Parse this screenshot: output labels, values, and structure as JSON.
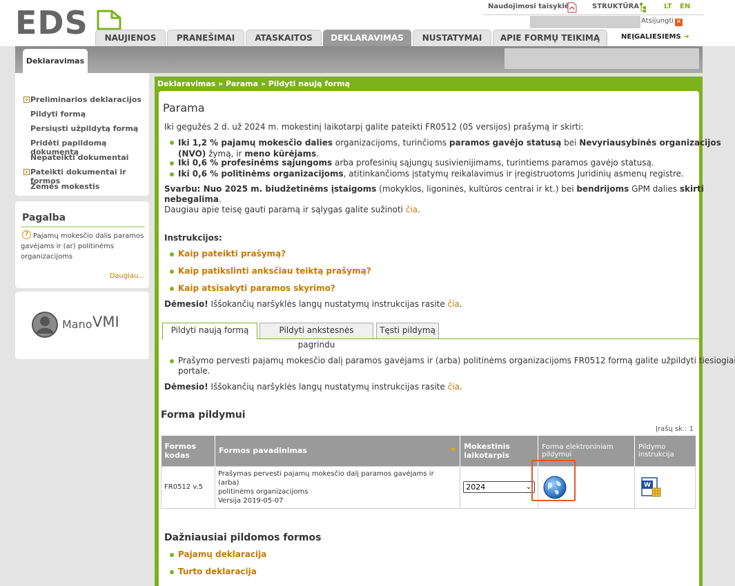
{
  "header": {
    "logo_text": "EDS",
    "links": {
      "rules": "Naudojimosi taisyklės",
      "structure": "STRUKTŪRA",
      "lt": "LT",
      "en": "EN"
    },
    "logout": "Atsijungti",
    "tabs": [
      "NAUJIENOS",
      "PRANEŠIMAI",
      "ATASKAITOS",
      "DEKLARAVIMAS",
      "NUSTATYMAI",
      "APIE FORMŲ TEIKIMĄ"
    ],
    "active_tab": "DEKLARAVIMAS",
    "disabled_link": "NEĮGALIESIEMS",
    "subtab": "Deklaravimas"
  },
  "sidebar": {
    "menu": [
      {
        "label": "Preliminarios deklaracijos",
        "expandable": true
      },
      {
        "label": "Pildyti formą",
        "expandable": false
      },
      {
        "label": "Persiųsti užpildytą formą",
        "expandable": false
      },
      {
        "label": "Pridėti papildomą dokumentą",
        "expandable": false
      },
      {
        "label": "Nepateikti dokumentai",
        "expandable": false
      },
      {
        "label": "Pateikti dokumentai ir formos",
        "expandable": true
      },
      {
        "label": "Žemės mokestis",
        "expandable": false
      }
    ],
    "help": {
      "title": "Pagalba",
      "text1": "Pajamų mokesčio dalis paramos",
      "text2": "gavėjams ir (ar) politinėms",
      "text3": "organizacijoms",
      "more": "Daugiau..."
    },
    "manovmi": {
      "mano": "Mano",
      "vmi": "VMI"
    }
  },
  "breadcrumb": "Deklaravimas » Parama » Pildyti naują formą",
  "main": {
    "title": "Parama",
    "intro": "Iki gegužės 2 d. už 2024 m. mokestinį laikotarpį galite pateikti FR0512 (05 versijos) prašymą ir skirti:",
    "b1_bold1": "Iki 1,2 % pajamų mokesčio dalies",
    "b1_t1": " organizacijoms, turinčioms ",
    "b1_bold2": "paramos gavėjo statusą",
    "b1_t2": " bei ",
    "b1_bold3": "Nevyriausybinės organizacijos",
    "b1_bold4": "(NVO)",
    "b1_t3": " žymą",
    "b1_t4": ", ir ",
    "b1_bold5": "meno kūrėjams",
    "b1_t5": ".",
    "b2_bold": "Iki 0,6 % profesinėms sąjungoms",
    "b2_t": " arba profesinių sąjungų susivienijimams, turintiems paramos gavėjo statusą.",
    "b3_bold": "Iki 0,6 % politinėms organizacijoms",
    "b3_t": ", atitinkančioms įstatymų reikalavimus ir įregistruotoms Juridinių asmenų registre.",
    "important_label": "Svarbu: Nuo 2025 m. biudžetinėms įstaigoms",
    "important_t1": " (mokyklos, ligoninės, kultūros centrai ir kt.) bei ",
    "important_bold2": "bendrijoms",
    "important_t2": " GPM dalies ",
    "important_bold3": "skirti",
    "important_bold4": "nebegalima",
    "important_t3": ".",
    "more_info": "Daugiau apie teisę gauti paramą ir sąlygas galite sužinoti ",
    "more_link": "čia",
    "more_end": ".",
    "instr_title": "Instrukcijos:",
    "instr_links": [
      "Kaip pateikti prašymą?",
      "Kaip patikslinti anksčiau teiktą prašymą?",
      "Kaip atsisakyti paramos skyrimo?"
    ],
    "attention_label": "Dėmesio!",
    "attention_text": " Iššokančių naršyklės langų nustatymų instrukcijas rasite ",
    "attention_link": "čia",
    "attention_end": "."
  },
  "form_tabs": [
    "Pildyti naują formą",
    "Pildyti ankstesnės pagrindu",
    "Tęsti pildymą"
  ],
  "tab_content": {
    "bullet_line1": "Prašymo pervesti pajamų mokesčio dalį paramos gavėjams ir (arba) politinėms organizacijoms FR0512 formą galite užpildyti tiesiogiai",
    "bullet_line2": "portale."
  },
  "form_section": {
    "title": "Forma pildymui",
    "count": "Įrašų sk.: 1",
    "headers": {
      "code1": "Formos",
      "code2": "kodas",
      "name": "Formos pavadinimas",
      "period1": "Mokestinis",
      "period2": "laikotarpis",
      "electronic1": "Forma elektroniniam",
      "electronic2": "pildymui",
      "instr1": "Pildymo",
      "instr2": "instrukcija"
    },
    "row": {
      "code": "FR0512 v.5",
      "name1": "Prašymas pervesti pajamų mokesčio dalį paramos gavėjams ir (arba)",
      "name2": "politinėms organizacijoms",
      "version": "Versija 2019-05-07",
      "period": "2024"
    }
  },
  "frequent": {
    "title": "Dažniausiai pildomos formos",
    "links": [
      "Pajamų deklaracija",
      "Turto deklaracija"
    ]
  },
  "colors": {
    "accent_green": "#7cb21b",
    "link_orange": "#c47a00",
    "tab_grey": "#9a9a9a",
    "highlight_red": "#e4572e"
  }
}
